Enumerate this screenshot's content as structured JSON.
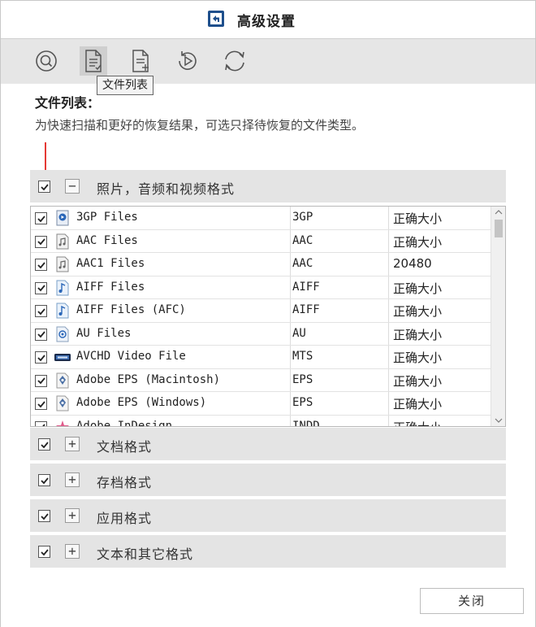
{
  "window": {
    "title": "高级设置",
    "colors": {
      "accent": "#1e4f8c",
      "toolbar_bg": "#e6e6e6",
      "group_bg": "#e4e4e4",
      "arrow": "#e53935"
    }
  },
  "toolbar": {
    "buttons": [
      {
        "icon": "search-icon"
      },
      {
        "icon": "file-list-icon"
      },
      {
        "icon": "add-file-icon"
      },
      {
        "icon": "replay-icon"
      },
      {
        "icon": "refresh-icon"
      }
    ],
    "tooltip": "文件列表"
  },
  "section": {
    "title": "文件列表：",
    "description": "为快速扫描和更好的恢复结果，可选只择待恢复的文件类型。"
  },
  "groups": [
    {
      "label": "照片，音频和视频格式",
      "expanded": true,
      "checked": true
    },
    {
      "label": "文档格式",
      "expanded": false,
      "checked": true
    },
    {
      "label": "存档格式",
      "expanded": false,
      "checked": true
    },
    {
      "label": "应用格式",
      "expanded": false,
      "checked": true
    },
    {
      "label": "文本和其它格式",
      "expanded": false,
      "checked": true
    }
  ],
  "files": [
    {
      "name": "3GP Files",
      "ext": "3GP",
      "size": "正确大小",
      "icon": "video-file-icon",
      "checked": true
    },
    {
      "name": "AAC Files",
      "ext": "AAC",
      "size": "正确大小",
      "icon": "audio-file-icon",
      "checked": true
    },
    {
      "name": "AAC1 Files",
      "ext": "AAC",
      "size": "20480",
      "icon": "audio-file-icon",
      "checked": true
    },
    {
      "name": "AIFF Files",
      "ext": "AIFF",
      "size": "正确大小",
      "icon": "music-file-icon",
      "checked": true
    },
    {
      "name": "AIFF Files (AFC)",
      "ext": "AIFF",
      "size": "正确大小",
      "icon": "music-file-icon",
      "checked": true
    },
    {
      "name": "AU Files",
      "ext": "AU",
      "size": "正确大小",
      "icon": "audio-file-icon",
      "checked": true
    },
    {
      "name": "AVCHD Video File",
      "ext": "MTS",
      "size": "正确大小",
      "icon": "avchd-icon",
      "checked": true
    },
    {
      "name": "Adobe EPS (Macintosh)",
      "ext": "EPS",
      "size": "正确大小",
      "icon": "eps-file-icon",
      "checked": true
    },
    {
      "name": "Adobe EPS (Windows)",
      "ext": "EPS",
      "size": "正确大小",
      "icon": "eps-file-icon",
      "checked": true
    },
    {
      "name": "Adobe InDesign",
      "ext": "INDD",
      "size": "正确大小",
      "icon": "indesign-file-icon",
      "checked": true
    }
  ],
  "footer": {
    "close_label": "关闭"
  }
}
